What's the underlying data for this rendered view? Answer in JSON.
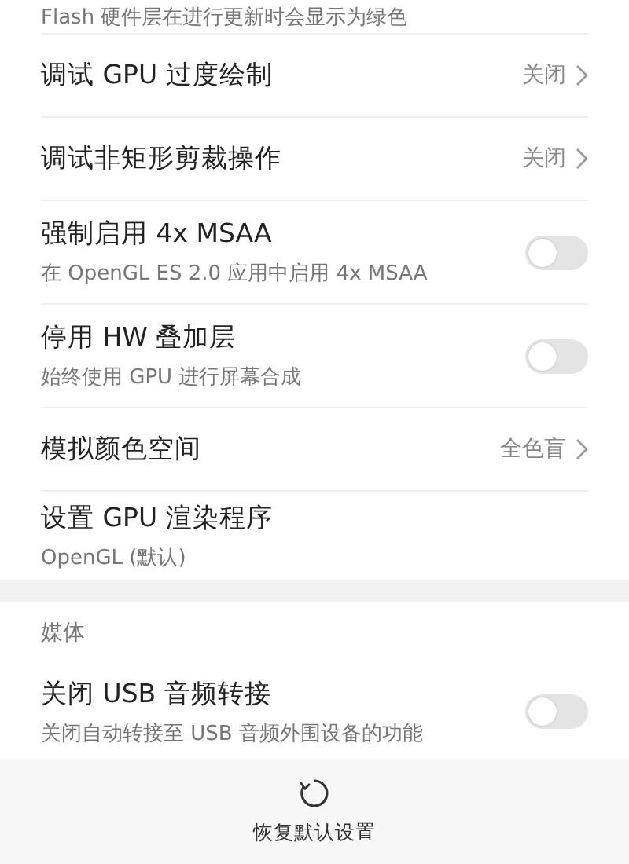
{
  "top_fragment": "Flash 硬件层在进行更新时会显示为绿色",
  "sections": [
    {
      "items": [
        {
          "kind": "value",
          "title": "调试 GPU 过度绘制",
          "value": "关闭"
        },
        {
          "kind": "value",
          "title": "调试非矩形剪裁操作",
          "value": "关闭"
        },
        {
          "kind": "toggle",
          "title": "强制启用 4x MSAA",
          "subtitle": "在 OpenGL ES 2.0 应用中启用 4x MSAA",
          "on": false
        },
        {
          "kind": "toggle",
          "title": "停用 HW 叠加层",
          "subtitle": "始终使用 GPU 进行屏幕合成",
          "on": false
        },
        {
          "kind": "value",
          "title": "模拟颜色空间",
          "value": "全色盲"
        },
        {
          "kind": "plain",
          "title": "设置 GPU 渲染程序",
          "subtitle": "OpenGL (默认)"
        }
      ]
    },
    {
      "header": "媒体",
      "items": [
        {
          "kind": "toggle",
          "title": "关闭 USB 音频转接",
          "subtitle": "关闭自动转接至 USB 音频外围设备的功能",
          "on": false
        }
      ]
    }
  ],
  "bottom_bar": {
    "label": "恢复默认设置"
  }
}
